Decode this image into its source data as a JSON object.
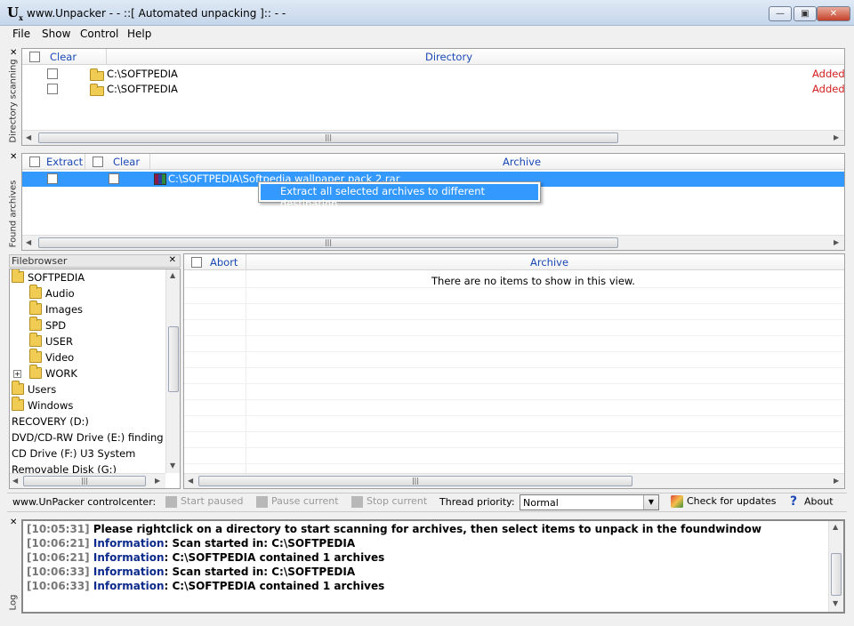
{
  "window": {
    "title": "www.Unpacker - - ::[ Automated unpacking ]:: - -"
  },
  "menu": [
    "File",
    "Show",
    "Control",
    "Help"
  ],
  "side_labels": {
    "dir": "Directory scanning",
    "found": "Found archives",
    "log": "Log"
  },
  "dir_scan": {
    "headers": {
      "clear": "Clear",
      "directory": "Directory"
    },
    "rows": [
      {
        "path": "C:\\SOFTPEDIA",
        "status": "Added"
      },
      {
        "path": "C:\\SOFTPEDIA",
        "status": "Added"
      }
    ]
  },
  "found_archives": {
    "headers": {
      "extract": "Extract",
      "clear": "Clear",
      "archive": "Archive"
    },
    "rows": [
      {
        "path": "C:\\SOFTPEDIA\\Softpedia wallpaper pack 2.rar"
      }
    ],
    "context_menu_item": "Extract all selected archives to different destination"
  },
  "filebrowser": {
    "title": "Filebrowser",
    "items": [
      {
        "label": "SOFTPEDIA",
        "depth": 0,
        "folder": true
      },
      {
        "label": "Audio",
        "depth": 1,
        "folder": true
      },
      {
        "label": "Images",
        "depth": 1,
        "folder": true
      },
      {
        "label": "SPD",
        "depth": 1,
        "folder": true
      },
      {
        "label": "USER",
        "depth": 1,
        "folder": true
      },
      {
        "label": "Video",
        "depth": 1,
        "folder": true
      },
      {
        "label": "WORK",
        "depth": 1,
        "folder": true,
        "expandable": true
      },
      {
        "label": "Users",
        "depth": 0,
        "folder": true
      },
      {
        "label": "Windows",
        "depth": 0,
        "folder": true
      },
      {
        "label": "RECOVERY (D:)",
        "depth": 0,
        "folder": false
      },
      {
        "label": "DVD/CD-RW Drive (E:) finding ne",
        "depth": 0,
        "folder": false
      },
      {
        "label": "CD Drive (F:) U3 System",
        "depth": 0,
        "folder": false
      },
      {
        "label": "Removable Disk (G:)",
        "depth": 0,
        "folder": false
      }
    ]
  },
  "unpack": {
    "headers": {
      "abort": "Abort",
      "archive": "Archive"
    },
    "empty_text": "There are no items to show in this view."
  },
  "toolbar": {
    "controlcenter": "www.UnPacker controlcenter:",
    "start_paused": "Start paused",
    "pause_current": "Pause current",
    "stop_current": "Stop current",
    "thread_priority_label": "Thread priority:",
    "thread_priority_value": "Normal",
    "check_updates": "Check for updates",
    "about": "About"
  },
  "log": [
    {
      "time": "[10:05:31]",
      "kind": "",
      "msg": "Please rightclick on a directory to start scanning for archives, then select items to unpack in the foundwindow"
    },
    {
      "time": "[10:06:21]",
      "kind": "Information",
      "msg": ": Scan started in: C:\\SOFTPEDIA"
    },
    {
      "time": "[10:06:21]",
      "kind": "Information",
      "msg": ": C:\\SOFTPEDIA contained 1 archives"
    },
    {
      "time": "[10:06:33]",
      "kind": "Information",
      "msg": ": Scan started in: C:\\SOFTPEDIA"
    },
    {
      "time": "[10:06:33]",
      "kind": "Information",
      "msg": ": C:\\SOFTPEDIA contained 1 archives"
    }
  ],
  "colors": {
    "selection": "#3399ff",
    "status_added": "#d42020",
    "header_text": "#1a49b5",
    "info_text": "#0c2a8c"
  }
}
